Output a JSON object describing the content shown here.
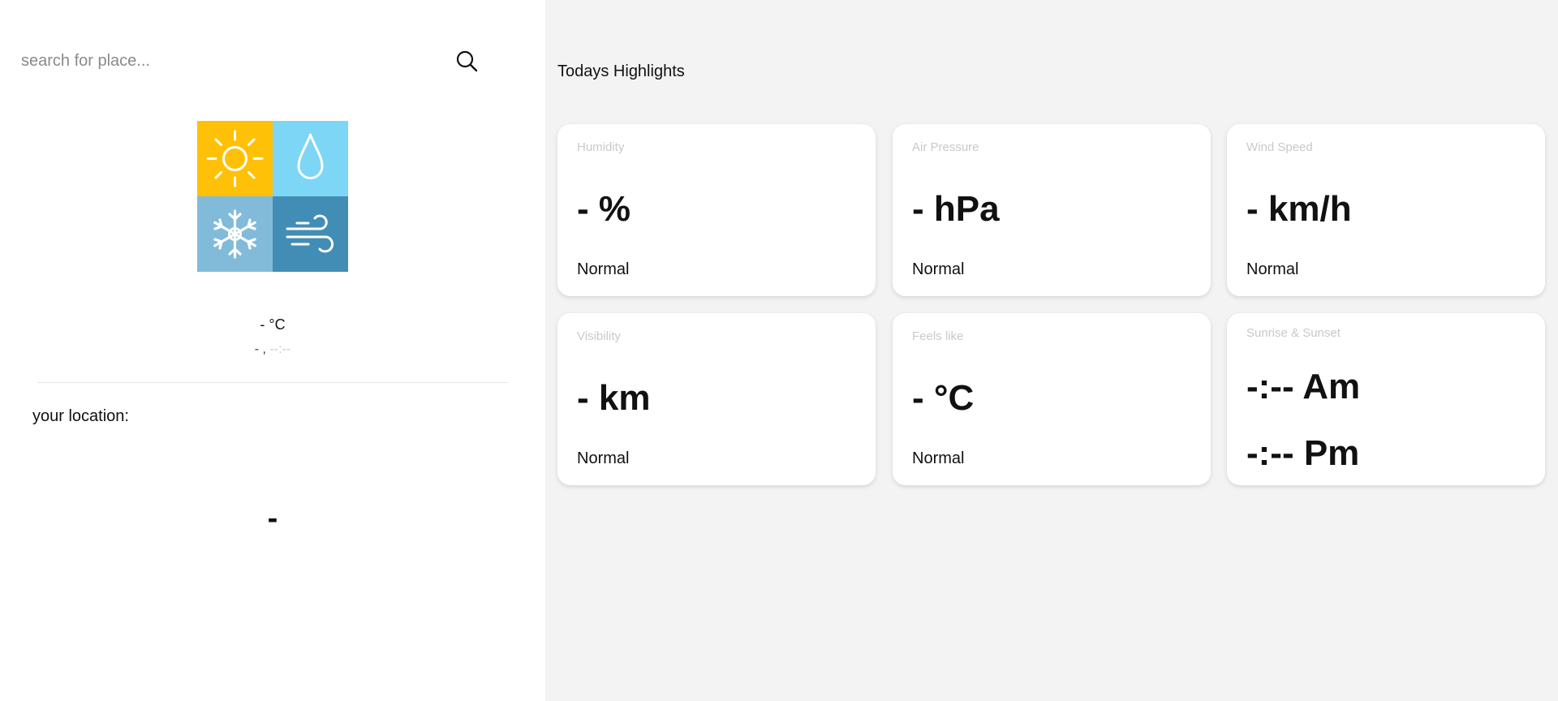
{
  "search": {
    "placeholder": "search for place..."
  },
  "current": {
    "temperature": "- °C",
    "day": "- ,",
    "time": "--:--"
  },
  "location": {
    "label": "your location:",
    "value": "-"
  },
  "highlights": {
    "title": "Todays Highlights",
    "humidity": {
      "label": "Humidity",
      "value": "- %",
      "status": "Normal"
    },
    "air_pressure": {
      "label": "Air Pressure",
      "value": "- hPa",
      "status": "Normal"
    },
    "wind_speed": {
      "label": "Wind Speed",
      "value": "- km/h",
      "status": "Normal"
    },
    "visibility": {
      "label": "Visibility",
      "value": "- km",
      "status": "Normal"
    },
    "feels_like": {
      "label": "Feels like",
      "value": "- °C",
      "status": "Normal"
    },
    "sunrise_sunset": {
      "label": "Sunrise & Sunset",
      "sunrise": "-:-- Am",
      "sunset": "-:-- Pm"
    }
  },
  "icons": {
    "search": "search-icon",
    "weather": [
      "sun-icon",
      "raindrop-icon",
      "snowflake-icon",
      "wind-icon"
    ]
  },
  "colors": {
    "sun_tile": "#ffc107",
    "rain_tile": "#7dd6f6",
    "snow_tile": "#82bbd9",
    "wind_tile": "#428db5",
    "page_bg": "#f3f3f3"
  }
}
